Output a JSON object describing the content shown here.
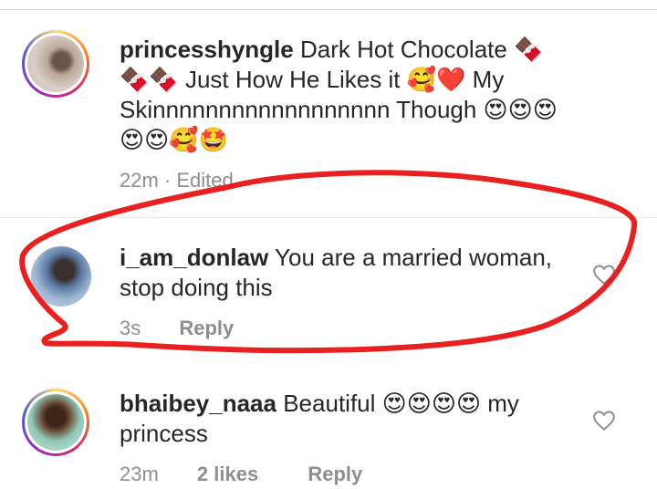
{
  "comments": [
    {
      "username": "princesshyngle",
      "text_lines": [
        "Dark Hot Chocolate 🍫",
        "🍫🍫 Just How He Likes it 🥰❤️ My",
        "Skinnnnnnnnnnnnnnnnnn Though 😍😍😍",
        "😍😍🥰🤩"
      ],
      "time": "22m",
      "edited": "· Edited"
    },
    {
      "username": "i_am_donlaw",
      "text_lines": [
        "You are a married woman,",
        "stop doing this"
      ],
      "time": "3s",
      "reply_label": "Reply"
    },
    {
      "username": "bhaibey_naaa",
      "text_lines": [
        "Beautiful 😍😍😍😍 my",
        "princess"
      ],
      "time": "23m",
      "likes": "2 likes",
      "reply_label": "Reply"
    }
  ],
  "icons": {
    "like": "heart-outline-icon",
    "annotation": "red-hand-drawn-circle"
  },
  "colors": {
    "text": "#262626",
    "meta": "#8e8e8e",
    "annotation": "#e8201f"
  }
}
